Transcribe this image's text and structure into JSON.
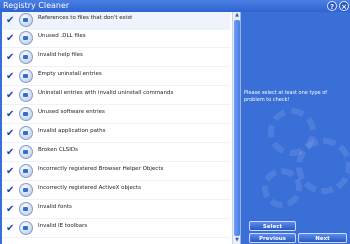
{
  "window": {
    "title": "Registry Cleaner",
    "help_label": "?",
    "close_label": "×"
  },
  "items": [
    {
      "label": "References to files that don't exist",
      "checked": true,
      "icon": "missing-file-icon"
    },
    {
      "label": "Unused .DLL files",
      "checked": true,
      "icon": "dll-icon"
    },
    {
      "label": "Invalid help files",
      "checked": true,
      "icon": "help-file-icon"
    },
    {
      "label": "Empty uninstall entries",
      "checked": true,
      "icon": "uninstall-icon"
    },
    {
      "label": "Uninstall entries with invalid uninstall commands",
      "checked": true,
      "icon": "uninstall-command-icon"
    },
    {
      "label": "Unused software entries",
      "checked": true,
      "icon": "software-icon"
    },
    {
      "label": "Invalid application paths",
      "checked": true,
      "icon": "application-path-icon"
    },
    {
      "label": "Broken CLSIDs",
      "checked": true,
      "icon": "clsid-icon"
    },
    {
      "label": "Incorrectly registered Browser Helper Objects",
      "checked": true,
      "icon": "browser-helper-icon"
    },
    {
      "label": "Incorrectly registered ActiveX objects",
      "checked": true,
      "icon": "activex-icon"
    },
    {
      "label": "Invalid fonts",
      "checked": true,
      "icon": "font-icon"
    },
    {
      "label": "Invalid IE toolbars",
      "checked": true,
      "icon": "toolbar-icon"
    }
  ],
  "message": "Please select at least one type of problem to check!",
  "buttons": {
    "select": "Select",
    "previous": "Previous",
    "next": "Next"
  },
  "scroll": {
    "up": "▲",
    "down": "▼"
  },
  "check_mark": "✔"
}
